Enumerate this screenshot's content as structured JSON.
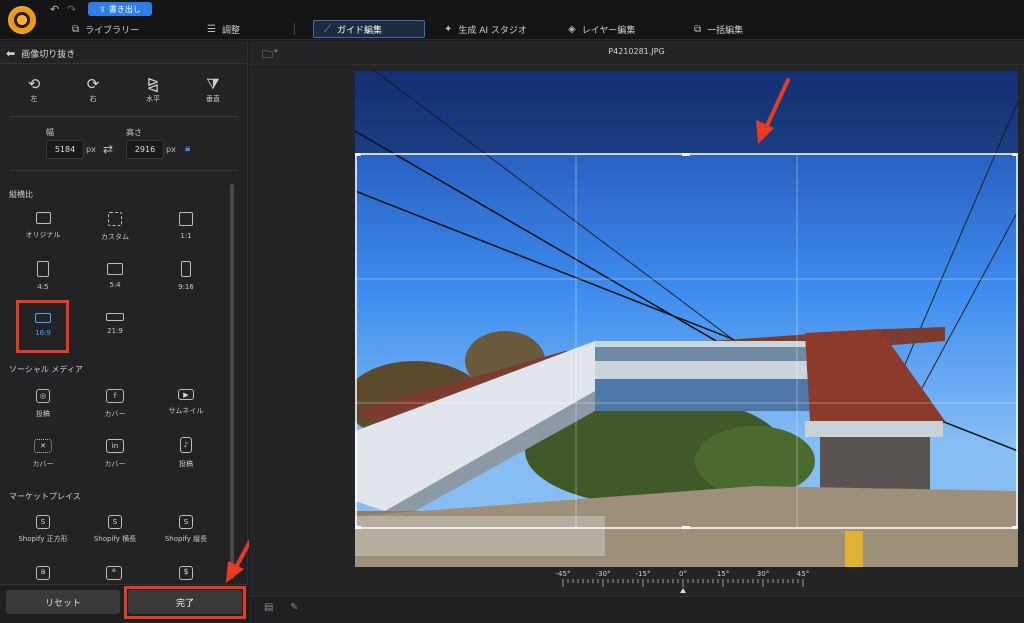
{
  "header": {
    "export_label": "書き出し",
    "tabs": [
      {
        "label": "ライブラリー",
        "icon": "library-icon"
      },
      {
        "label": "調整",
        "icon": "sliders-icon"
      },
      {
        "label": "ガイド編集",
        "icon": "magic-wand-icon",
        "active": true
      },
      {
        "label": "生成 AI スタジオ",
        "icon": "sparkle-icon"
      },
      {
        "label": "レイヤー編集",
        "icon": "layers-icon"
      },
      {
        "label": "一括編集",
        "icon": "batch-icon"
      }
    ]
  },
  "panel": {
    "title": "画像切り抜き",
    "rotate": [
      {
        "label": "左",
        "icon": "rotate-left-icon"
      },
      {
        "label": "右",
        "icon": "rotate-right-icon"
      },
      {
        "label": "水平",
        "icon": "flip-horizontal-icon"
      },
      {
        "label": "垂直",
        "icon": "flip-vertical-icon"
      }
    ],
    "width_label": "幅",
    "height_label": "高さ",
    "width_value": "5184",
    "height_value": "2916",
    "unit": "px",
    "aspect_title": "縦横比",
    "aspect_presets": [
      {
        "label": "オリジナル"
      },
      {
        "label": "カスタム"
      },
      {
        "label": "1:1"
      },
      {
        "label": "4:5"
      },
      {
        "label": "5:4"
      },
      {
        "label": "9:16"
      },
      {
        "label": "16:9",
        "selected": true
      },
      {
        "label": "21:9"
      }
    ],
    "social_title": "ソーシャル メディア",
    "social_presets": [
      {
        "label": "投稿"
      },
      {
        "label": "カバー"
      },
      {
        "label": "サムネイル"
      },
      {
        "label": "カバー"
      },
      {
        "label": "カバー"
      },
      {
        "label": "投稿"
      }
    ],
    "market_title": "マーケットプレイス",
    "market_presets": [
      {
        "label": "Shopify 正方形"
      },
      {
        "label": "Shopify 横長"
      },
      {
        "label": "Shopify 縦長"
      }
    ],
    "reset_label": "リセット",
    "done_label": "完了"
  },
  "canvas": {
    "filename": "P4210281.JPG",
    "ruler_ticks": [
      "-45°",
      "-30°",
      "-15°",
      "0°",
      "15°",
      "30°",
      "45°"
    ],
    "rotation_value": 0
  },
  "colors": {
    "accent": "#2f7ee8",
    "selection": "#4aa3ff",
    "highlight_red": "#e53a24"
  }
}
